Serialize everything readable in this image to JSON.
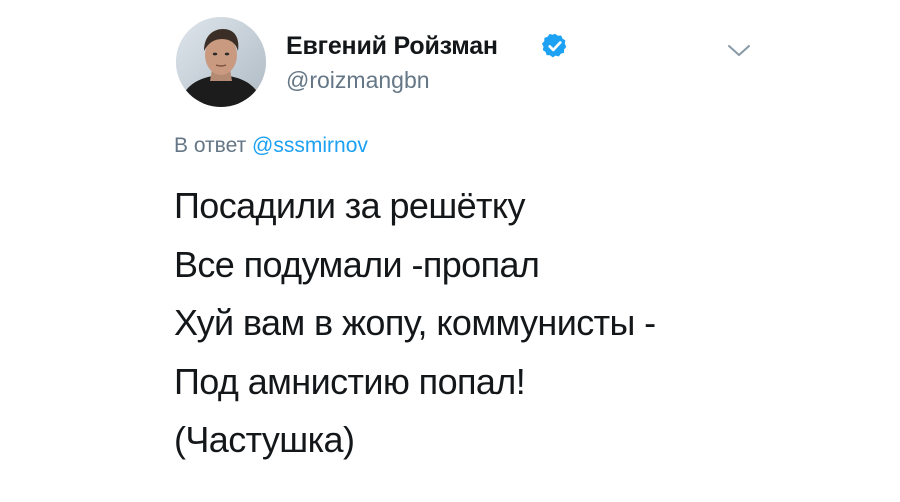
{
  "tweet": {
    "author": {
      "name": "Евгений Ройзман",
      "handle": "@roizmangbn",
      "verified": true
    },
    "reply": {
      "prefix": "В ответ",
      "mention": "@sssmirnov"
    },
    "lines": [
      "Посадили за решётку",
      "Все подумали -пропал",
      "Хуй вам в жопу, коммунисты -",
      "Под амнистию попал!",
      "(Частушка)"
    ]
  },
  "icons": {
    "verified": "verified-badge-icon",
    "menu": "chevron-down-icon"
  },
  "colors": {
    "text": "#14171a",
    "secondary": "#657786",
    "accent": "#1da1f2"
  }
}
